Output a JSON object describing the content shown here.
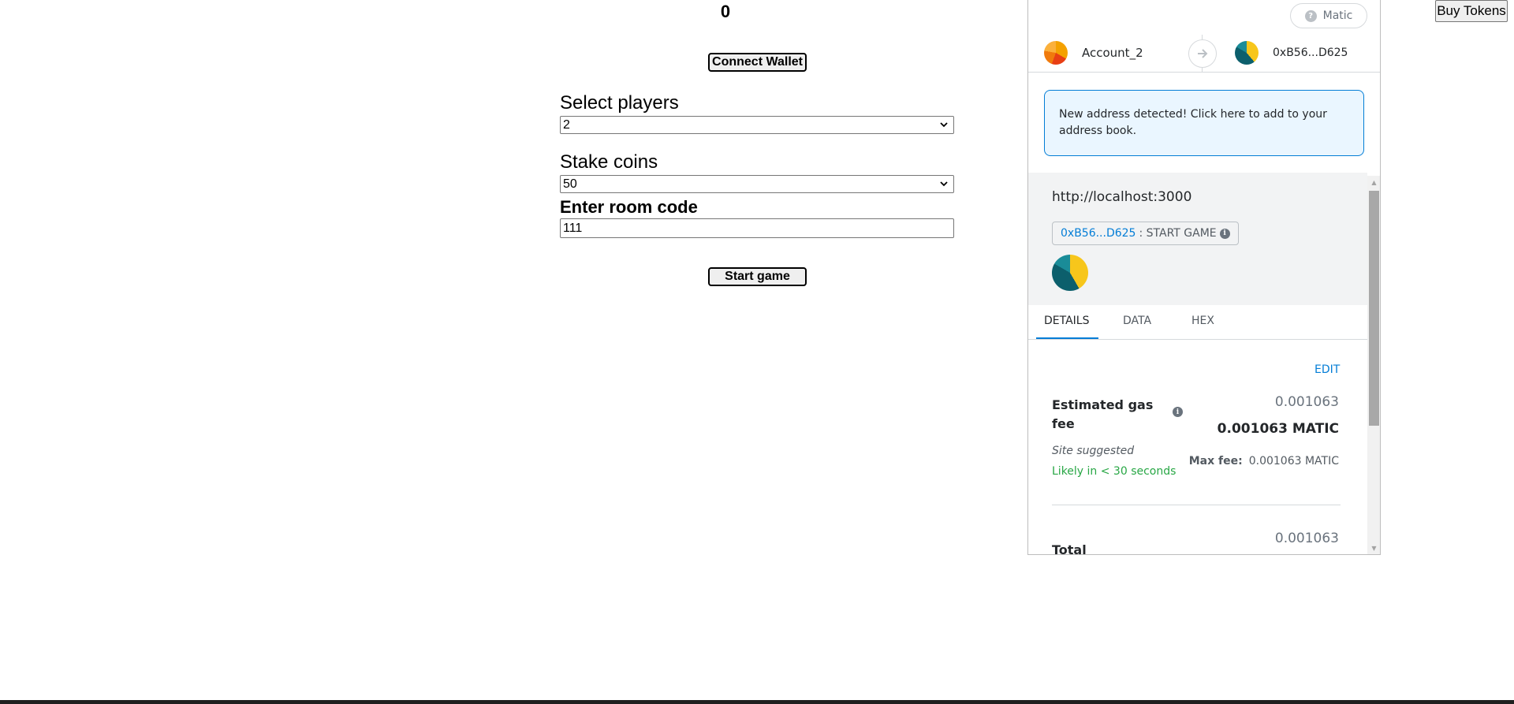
{
  "game": {
    "balance": "0",
    "connect_label": "Connect Wallet",
    "players_label": "Select players",
    "players_value": "2",
    "stake_label": "Stake coins",
    "stake_value": "50",
    "room_label": "Enter room code",
    "room_value": "111",
    "start_label": "Start game",
    "buy_label": "Buy Tokens"
  },
  "metamask": {
    "network": "Matic",
    "network_icon": "?",
    "from_account": "Account_2",
    "to_address": "0xB56...D625",
    "notice": "New address detected! Click here to add to your address book.",
    "origin": "http://localhost:3000",
    "method_address": "0xB56...D625",
    "method_name": ": START GAME",
    "tabs": [
      "DETAILS",
      "DATA",
      "HEX"
    ],
    "active_tab": "DETAILS",
    "edit_label": "EDIT",
    "gas_title": "Estimated gas fee",
    "gas_fiat": "0.001063",
    "gas_native": "0.001063 MATIC",
    "site_suggested": "Site suggested",
    "likely": "Likely in < 30 seconds",
    "max_fee_label": "Max fee:",
    "max_fee_value": "0.001063 MATIC",
    "total_fiat": "0.001063",
    "total_label": "Total",
    "colors": {
      "accent": "#037dd6",
      "success": "#28a745",
      "notice_bg": "#eaf6ff"
    }
  }
}
